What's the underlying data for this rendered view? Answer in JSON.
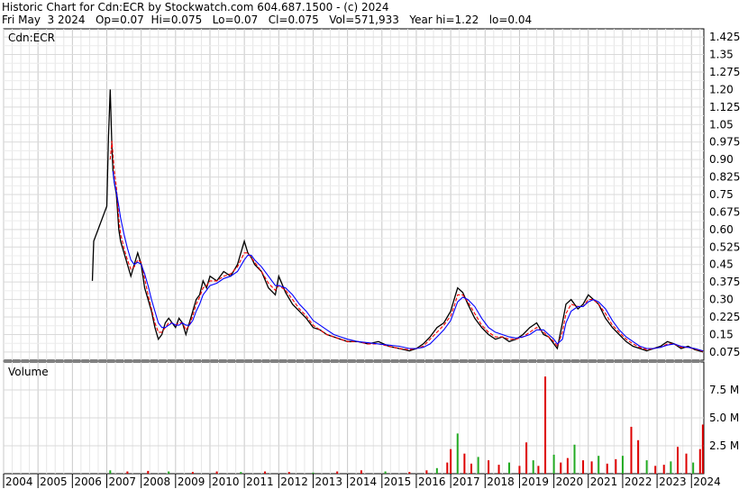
{
  "header": {
    "line1": "Historic Chart for Cdn:ECR by Stockwatch.com 604.687.1500 - (c) 2024",
    "line2": "Fri May  3 2024   Op=0.07  Hi=0.075   Lo=0.07   Cl=0.075   Vol=571,933   Year hi=1.22   lo=0.04"
  },
  "chart_data": {
    "type": "line",
    "symbol_label": "Cdn:ECR",
    "volume_label": "Volume",
    "x_tick_labels": [
      "2004",
      "2005",
      "2006",
      "2007",
      "2008",
      "2009",
      "2010",
      "2011",
      "2012",
      "2013",
      "2014",
      "2015",
      "2016",
      "2017",
      "2018",
      "2019",
      "2020",
      "2021",
      "2022",
      "2023",
      "2024"
    ],
    "xlim": [
      2004.0,
      2024.36
    ],
    "price_ylim": [
      0.04,
      1.46
    ],
    "price_ticks": [
      {
        "value": 1.425,
        "label": "1.425"
      },
      {
        "value": 1.35,
        "label": "1.35"
      },
      {
        "value": 1.275,
        "label": "1.275"
      },
      {
        "value": 1.2,
        "label": "1.20"
      },
      {
        "value": 1.125,
        "label": "1.125"
      },
      {
        "value": 1.05,
        "label": "1.05"
      },
      {
        "value": 0.975,
        "label": "0.975"
      },
      {
        "value": 0.9,
        "label": "0.90"
      },
      {
        "value": 0.825,
        "label": "0.825"
      },
      {
        "value": 0.75,
        "label": "0.75"
      },
      {
        "value": 0.675,
        "label": "0.675"
      },
      {
        "value": 0.6,
        "label": "0.60"
      },
      {
        "value": 0.525,
        "label": "0.525"
      },
      {
        "value": 0.45,
        "label": "0.45"
      },
      {
        "value": 0.375,
        "label": "0.375"
      },
      {
        "value": 0.3,
        "label": "0.30"
      },
      {
        "value": 0.225,
        "label": "0.225"
      },
      {
        "value": 0.15,
        "label": "0.15"
      },
      {
        "value": 0.075,
        "label": "0.075"
      }
    ],
    "volume_ylim": [
      0,
      10000000
    ],
    "volume_ticks": [
      {
        "value": 2500000,
        "label": "2.5 M"
      },
      {
        "value": 5000000,
        "label": "5.0 M"
      },
      {
        "value": 7500000,
        "label": "7.5 M"
      }
    ],
    "price_x": [
      2006.58,
      2006.62,
      2007.0,
      2007.05,
      2007.1,
      2007.15,
      2007.18,
      2007.22,
      2007.28,
      2007.35,
      2007.4,
      2007.5,
      2007.6,
      2007.7,
      2007.8,
      2007.9,
      2008.0,
      2008.1,
      2008.2,
      2008.3,
      2008.4,
      2008.5,
      2008.6,
      2008.7,
      2008.8,
      2008.9,
      2009.0,
      2009.1,
      2009.2,
      2009.3,
      2009.4,
      2009.5,
      2009.6,
      2009.7,
      2009.8,
      2009.9,
      2010.0,
      2010.2,
      2010.4,
      2010.6,
      2010.8,
      2011.0,
      2011.1,
      2011.2,
      2011.3,
      2011.5,
      2011.7,
      2011.9,
      2012.0,
      2012.2,
      2012.4,
      2012.6,
      2012.8,
      2013.0,
      2013.2,
      2013.4,
      2013.6,
      2013.8,
      2014.0,
      2014.3,
      2014.6,
      2014.9,
      2015.2,
      2015.5,
      2015.8,
      2016.0,
      2016.2,
      2016.4,
      2016.6,
      2016.8,
      2017.0,
      2017.1,
      2017.2,
      2017.35,
      2017.5,
      2017.7,
      2017.9,
      2018.1,
      2018.3,
      2018.5,
      2018.7,
      2018.9,
      2019.1,
      2019.3,
      2019.5,
      2019.7,
      2019.85,
      2020.0,
      2020.1,
      2020.25,
      2020.35,
      2020.5,
      2020.7,
      2020.85,
      2021.0,
      2021.15,
      2021.3,
      2021.5,
      2021.7,
      2021.9,
      2022.1,
      2022.3,
      2022.5,
      2022.7,
      2022.9,
      2023.1,
      2023.3,
      2023.5,
      2023.7,
      2023.9,
      2024.1,
      2024.34
    ],
    "series": [
      {
        "name": "",
        "color": "#000000",
        "values": [
          0.38,
          0.55,
          0.7,
          1.0,
          1.2,
          0.95,
          0.85,
          0.8,
          0.75,
          0.6,
          0.55,
          0.5,
          0.45,
          0.4,
          0.45,
          0.5,
          0.45,
          0.35,
          0.3,
          0.25,
          0.18,
          0.13,
          0.15,
          0.2,
          0.22,
          0.2,
          0.18,
          0.22,
          0.2,
          0.15,
          0.2,
          0.25,
          0.3,
          0.32,
          0.38,
          0.35,
          0.4,
          0.38,
          0.42,
          0.4,
          0.45,
          0.55,
          0.5,
          0.48,
          0.45,
          0.42,
          0.35,
          0.32,
          0.4,
          0.33,
          0.28,
          0.25,
          0.22,
          0.18,
          0.17,
          0.15,
          0.14,
          0.13,
          0.12,
          0.12,
          0.11,
          0.12,
          0.1,
          0.09,
          0.08,
          0.09,
          0.11,
          0.14,
          0.18,
          0.2,
          0.25,
          0.3,
          0.35,
          0.33,
          0.28,
          0.22,
          0.18,
          0.15,
          0.13,
          0.14,
          0.12,
          0.13,
          0.15,
          0.18,
          0.2,
          0.15,
          0.14,
          0.11,
          0.09,
          0.2,
          0.28,
          0.3,
          0.26,
          0.28,
          0.32,
          0.3,
          0.28,
          0.22,
          0.18,
          0.15,
          0.12,
          0.1,
          0.09,
          0.08,
          0.09,
          0.1,
          0.12,
          0.11,
          0.09,
          0.1,
          0.085,
          0.075
        ]
      },
      {
        "name": "",
        "color": "#ff0000",
        "values": [
          null,
          null,
          null,
          null,
          0.9,
          0.98,
          0.92,
          0.85,
          0.78,
          0.65,
          0.58,
          0.52,
          0.47,
          0.43,
          0.44,
          0.47,
          0.46,
          0.39,
          0.32,
          0.26,
          0.2,
          0.16,
          0.16,
          0.18,
          0.2,
          0.2,
          0.19,
          0.2,
          0.2,
          0.17,
          0.19,
          0.23,
          0.28,
          0.31,
          0.35,
          0.36,
          0.38,
          0.38,
          0.4,
          0.41,
          0.44,
          0.5,
          0.5,
          0.48,
          0.46,
          0.42,
          0.37,
          0.34,
          0.36,
          0.34,
          0.3,
          0.26,
          0.23,
          0.19,
          0.17,
          0.15,
          0.14,
          0.13,
          0.12,
          0.12,
          0.11,
          0.11,
          0.1,
          0.09,
          0.085,
          0.09,
          0.1,
          0.13,
          0.16,
          0.19,
          0.23,
          0.27,
          0.32,
          0.32,
          0.29,
          0.24,
          0.19,
          0.16,
          0.14,
          0.14,
          0.13,
          0.13,
          0.14,
          0.16,
          0.18,
          0.16,
          0.14,
          0.12,
          0.1,
          0.16,
          0.24,
          0.28,
          0.27,
          0.27,
          0.3,
          0.3,
          0.28,
          0.24,
          0.19,
          0.16,
          0.13,
          0.11,
          0.095,
          0.085,
          0.09,
          0.095,
          0.11,
          0.11,
          0.095,
          0.095,
          0.088,
          0.078
        ]
      },
      {
        "name": "",
        "color": "#0000ff",
        "values": [
          null,
          null,
          null,
          null,
          null,
          null,
          0.85,
          0.8,
          0.76,
          0.7,
          0.65,
          0.58,
          0.52,
          0.47,
          0.45,
          0.46,
          0.45,
          0.41,
          0.36,
          0.3,
          0.25,
          0.2,
          0.18,
          0.18,
          0.19,
          0.2,
          0.19,
          0.19,
          0.2,
          0.19,
          0.19,
          0.21,
          0.25,
          0.28,
          0.32,
          0.34,
          0.36,
          0.37,
          0.39,
          0.4,
          0.42,
          0.47,
          0.49,
          0.49,
          0.47,
          0.44,
          0.4,
          0.36,
          0.36,
          0.35,
          0.32,
          0.28,
          0.25,
          0.21,
          0.19,
          0.17,
          0.15,
          0.14,
          0.13,
          0.12,
          0.115,
          0.11,
          0.105,
          0.1,
          0.09,
          0.09,
          0.095,
          0.11,
          0.14,
          0.17,
          0.21,
          0.25,
          0.29,
          0.31,
          0.3,
          0.27,
          0.22,
          0.18,
          0.16,
          0.15,
          0.14,
          0.135,
          0.14,
          0.15,
          0.17,
          0.17,
          0.15,
          0.13,
          0.11,
          0.13,
          0.2,
          0.25,
          0.27,
          0.27,
          0.29,
          0.3,
          0.29,
          0.26,
          0.21,
          0.17,
          0.14,
          0.12,
          0.1,
          0.09,
          0.09,
          0.095,
          0.105,
          0.11,
          0.1,
          0.095,
          0.09,
          0.08
        ]
      }
    ],
    "volume": {
      "x": [
        2007.1,
        2007.6,
        2008.2,
        2008.8,
        2009.5,
        2010.2,
        2010.9,
        2011.6,
        2012.3,
        2013.0,
        2013.7,
        2014.4,
        2015.1,
        2015.8,
        2016.3,
        2016.6,
        2016.9,
        2017.0,
        2017.2,
        2017.4,
        2017.6,
        2017.8,
        2018.1,
        2018.4,
        2018.7,
        2019.0,
        2019.2,
        2019.4,
        2019.55,
        2019.75,
        2020.0,
        2020.2,
        2020.4,
        2020.6,
        2020.85,
        2021.1,
        2021.3,
        2021.55,
        2021.8,
        2022.0,
        2022.25,
        2022.45,
        2022.7,
        2022.95,
        2023.2,
        2023.4,
        2023.6,
        2023.85,
        2024.05,
        2024.25,
        2024.33
      ],
      "values": [
        300000,
        200000,
        250000,
        200000,
        150000,
        200000,
        150000,
        200000,
        150000,
        100000,
        200000,
        300000,
        200000,
        150000,
        300000,
        500000,
        1000000,
        2200000,
        3600000,
        1800000,
        900000,
        1500000,
        1200000,
        800000,
        1000000,
        700000,
        2800000,
        1200000,
        700000,
        8700000,
        1700000,
        1000000,
        1400000,
        2600000,
        1200000,
        1100000,
        1600000,
        900000,
        1300000,
        1600000,
        4200000,
        3000000,
        1200000,
        700000,
        800000,
        1100000,
        2400000,
        1800000,
        1000000,
        2200000,
        4400000
      ]
    }
  }
}
